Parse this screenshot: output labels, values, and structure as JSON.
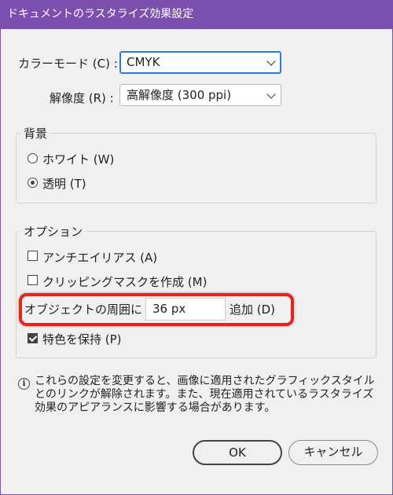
{
  "window": {
    "title": "ドキュメントのラスタライズ効果設定"
  },
  "color_mode": {
    "label": "カラーモード (C) :",
    "value": "CMYK"
  },
  "resolution": {
    "label": "解像度 (R) :",
    "value": "高解像度 (300 ppi)"
  },
  "background": {
    "title": "背景",
    "options": [
      {
        "label": "ホワイト (W)",
        "selected": false
      },
      {
        "label": "透明 (T)",
        "selected": true
      }
    ]
  },
  "options": {
    "title": "オプション",
    "antialias": {
      "label": "アンチエイリアス (A)",
      "checked": false
    },
    "clipping_mask": {
      "label": "クリッピングマスクを作成 (M)",
      "checked": false
    },
    "padding": {
      "label": "オブジェクトの周囲に",
      "value": "36 px",
      "suffix": "追加 (D)"
    },
    "spot_color": {
      "label": "特色を保持 (P)",
      "checked": true
    }
  },
  "info": {
    "icon": "info-icon",
    "text": "これらの設定を変更すると、画像に適用されたグラフィックスタイルとのリンクが解除されます。また、現在適用されているラスタライズ効果のアピアランスに影響する場合があります。"
  },
  "buttons": {
    "ok": "OK",
    "cancel": "キャンセル"
  },
  "colors": {
    "titlebar": "#7a4fae",
    "highlight": "#e6231f",
    "focus": "#2a7cd6"
  }
}
